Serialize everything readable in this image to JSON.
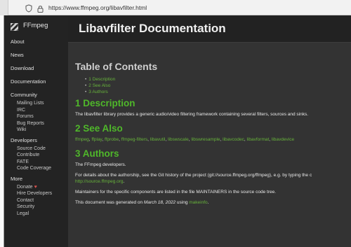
{
  "browser": {
    "url": "https://www.ffmpeg.org/libavfilter.html"
  },
  "sidebar": {
    "brand": "FFmpeg",
    "items": [
      {
        "label": "About"
      },
      {
        "label": "News"
      },
      {
        "label": "Download"
      },
      {
        "label": "Documentation"
      }
    ],
    "community": {
      "label": "Community",
      "items": [
        "Mailing Lists",
        "IRC",
        "Forums",
        "Bug Reports",
        "Wiki"
      ]
    },
    "developers": {
      "label": "Developers",
      "items": [
        "Source Code",
        "Contribute",
        "FATE",
        "Code Coverage"
      ]
    },
    "more": {
      "label": "More",
      "items": [
        "Donate",
        "Hire Developers",
        "Contact",
        "Security",
        "Legal"
      ]
    }
  },
  "page": {
    "title": "Libavfilter Documentation",
    "toc_title": "Table of Contents",
    "toc": [
      "1 Description",
      "2 See Also",
      "3 Authors"
    ],
    "sections": {
      "description": {
        "title": "1 Description",
        "text": "The libavfilter library provides a generic audio/video filtering framework containing several filters, sources and sinks."
      },
      "see_also": {
        "title": "2 See Also",
        "links": [
          "ffmpeg",
          "ffplay",
          "ffprobe",
          "ffmpeg-filters",
          "libavutil",
          "libswscale",
          "libswresample",
          "libavcodec",
          "libavformat",
          "libavdevice"
        ]
      },
      "authors": {
        "title": "3 Authors",
        "p1": "The FFmpeg developers.",
        "p2": "For details about the authorship, see the Git history of the project (git://source.ffmpeg.org/ffmpeg), e.g. by typing the c",
        "p2_link": "http://source.ffmpeg.org",
        "p2_end": ".",
        "p3": "Maintainers for the specific components are listed in the file MAINTAINERS in the source code tree.",
        "gen_prefix": "This document was generated on ",
        "gen_date": "March 18, 2022",
        "gen_using": " using ",
        "gen_tool": "makeinfo",
        "gen_end": "."
      }
    }
  }
}
